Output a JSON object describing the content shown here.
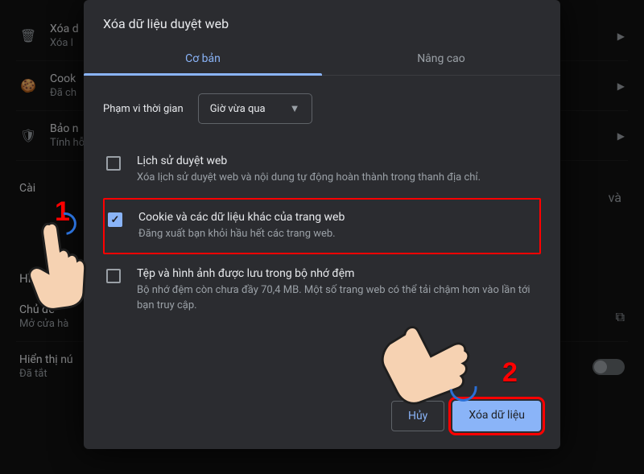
{
  "bg": {
    "rows": [
      {
        "icon": "🗑",
        "title": "Xóa d",
        "sub": "Xóa l"
      },
      {
        "icon": "🍪",
        "title": "Cook",
        "sub": "Đã ch"
      },
      {
        "icon": "🛡",
        "title": "Bảo n",
        "sub": "Tính hỗ,  bảo m"
      }
    ],
    "caidat_label": "Cài",
    "hinhthuc_label": "Hình thức",
    "chude": {
      "title": "Chủ đề",
      "sub": "Mở cửa hà"
    },
    "hienthi": {
      "title": "Hiển thị nú",
      "sub": "Đã tắt"
    },
    "va_suffix": "và"
  },
  "dialog": {
    "title": "Xóa dữ liệu duyệt web",
    "tabs": {
      "basic": "Cơ bản",
      "advanced": "Nâng cao"
    },
    "time_label": "Phạm vi thời gian",
    "time_value": "Giờ vừa qua",
    "options": [
      {
        "title": "Lịch sử duyệt web",
        "sub": "Xóa lịch sử duyệt web và nội dung tự động hoàn thành trong thanh địa chỉ.",
        "checked": false,
        "highlight": false
      },
      {
        "title": "Cookie và các dữ liệu khác của trang web",
        "sub": "Đăng xuất bạn khỏi hầu hết các trang web.",
        "checked": true,
        "highlight": true
      },
      {
        "title": "Tệp và hình ảnh được lưu trong bộ nhớ đệm",
        "sub": "Bộ nhớ đệm còn chưa đầy 70,4 MB. Một số trang web có thể tải chậm hơn vào lần tới bạn truy cập.",
        "checked": false,
        "highlight": false
      }
    ],
    "cancel": "Hủy",
    "confirm": "Xóa dữ liệu"
  },
  "annotations": {
    "one": "1",
    "two": "2"
  }
}
